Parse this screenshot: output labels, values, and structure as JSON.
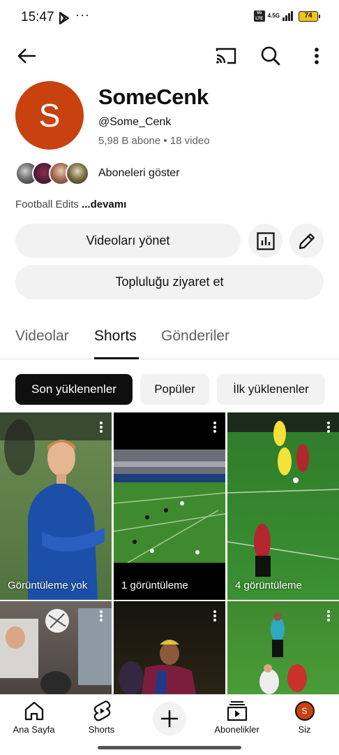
{
  "status_bar": {
    "time": "15:47",
    "volte": "Vo LTE",
    "network": "4.5G",
    "battery": "74"
  },
  "channel": {
    "avatar_letter": "S",
    "name": "SomeCenk",
    "handle": "@Some_Cenk",
    "stats": "5,98 B abone • 18 video",
    "subscribers_link": "Aboneleri göster",
    "description": "Football Edits",
    "description_more": "...devamı",
    "avatar_color": "#c8420f"
  },
  "actions": {
    "manage_videos": "Videoları yönet",
    "visit_community": "Topluluğu ziyaret et"
  },
  "tabs": [
    {
      "label": "Videolar",
      "active": false
    },
    {
      "label": "Shorts",
      "active": true
    },
    {
      "label": "Gönderiler",
      "active": false
    }
  ],
  "filters": [
    {
      "label": "Son yüklenenler",
      "selected": true
    },
    {
      "label": "Popüler",
      "selected": false
    },
    {
      "label": "İlk yüklenenler",
      "selected": false
    }
  ],
  "shorts": [
    {
      "views": "Görüntüleme yok",
      "thumb": "player-portrait"
    },
    {
      "views": "1 görüntüleme",
      "thumb": "stadium-wide"
    },
    {
      "views": "4 görüntüleme",
      "thumb": "pitch-action"
    },
    {
      "views": "",
      "thumb": "header-duel"
    },
    {
      "views": "",
      "thumb": "dark-player"
    },
    {
      "views": "",
      "thumb": "referee-tackle"
    }
  ],
  "bottom_nav": [
    {
      "label": "Ana Sayfa",
      "icon": "home-icon"
    },
    {
      "label": "Shorts",
      "icon": "shorts-icon"
    },
    {
      "label": "",
      "icon": "create-icon"
    },
    {
      "label": "Abonelikler",
      "icon": "subscriptions-icon"
    },
    {
      "label": "Siz",
      "icon": "profile-icon"
    }
  ]
}
